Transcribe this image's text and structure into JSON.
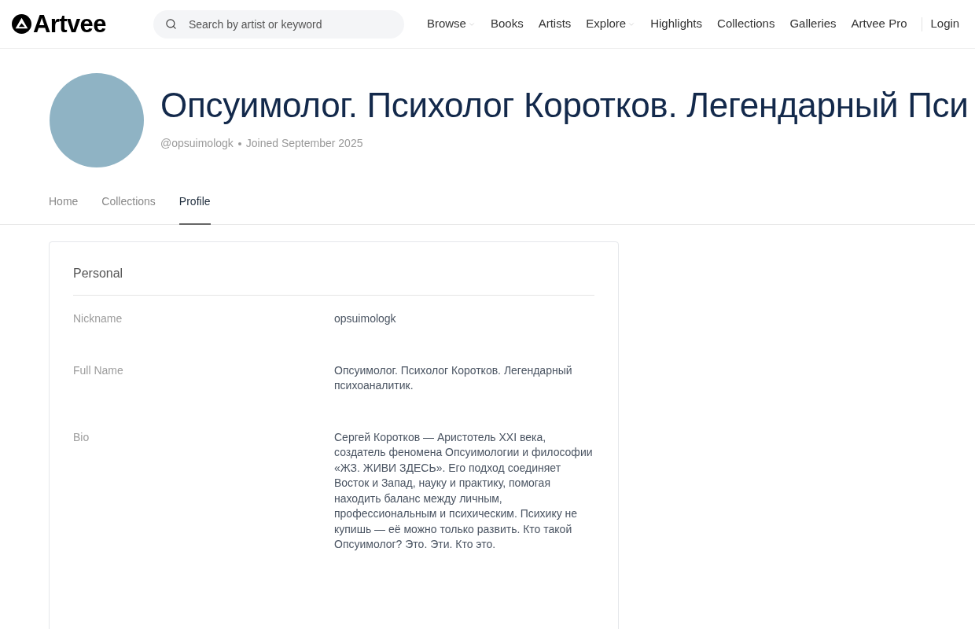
{
  "header": {
    "logo": "Artvee",
    "search": {
      "placeholder": "Search by artist or keyword"
    },
    "nav": [
      {
        "label": "Browse",
        "dropdown": true
      },
      {
        "label": "Books",
        "dropdown": false
      },
      {
        "label": "Artists",
        "dropdown": false
      },
      {
        "label": "Explore",
        "dropdown": true
      },
      {
        "label": "Highlights",
        "dropdown": false
      },
      {
        "label": "Collections",
        "dropdown": false
      },
      {
        "label": "Galleries",
        "dropdown": false
      },
      {
        "label": "Artvee Pro",
        "dropdown": false
      }
    ],
    "login": "Login"
  },
  "profile": {
    "title": "Опсуимолог. Психолог Коротков. Легендарный Пси",
    "handle": "@opsuimologk",
    "joined": "Joined September 2025"
  },
  "tabs": [
    {
      "label": "Home",
      "selected": false
    },
    {
      "label": "Collections",
      "selected": false
    },
    {
      "label": "Profile",
      "selected": true
    }
  ],
  "card": {
    "heading": "Personal",
    "fields": [
      {
        "label": "Nickname",
        "value": "opsuimologk"
      },
      {
        "label": "Full Name",
        "value": "Опсуимолог. Психолог Коротков. Легендарный психоаналитик."
      },
      {
        "label": "Bio",
        "value": "Сергей Коротков — Аристотель XXI века, создатель феномена Опсуимологии и философии «ЖЗ. ЖИВИ ЗДЕСЬ». Его подход соединяет Восток и Запад, науку и практику, помогая находить баланс между личным, профессиональным и психическим. Психику не купишь — её можно только развить. Кто такой Опсуимолог? Это. Эти. Кто это."
      }
    ]
  }
}
